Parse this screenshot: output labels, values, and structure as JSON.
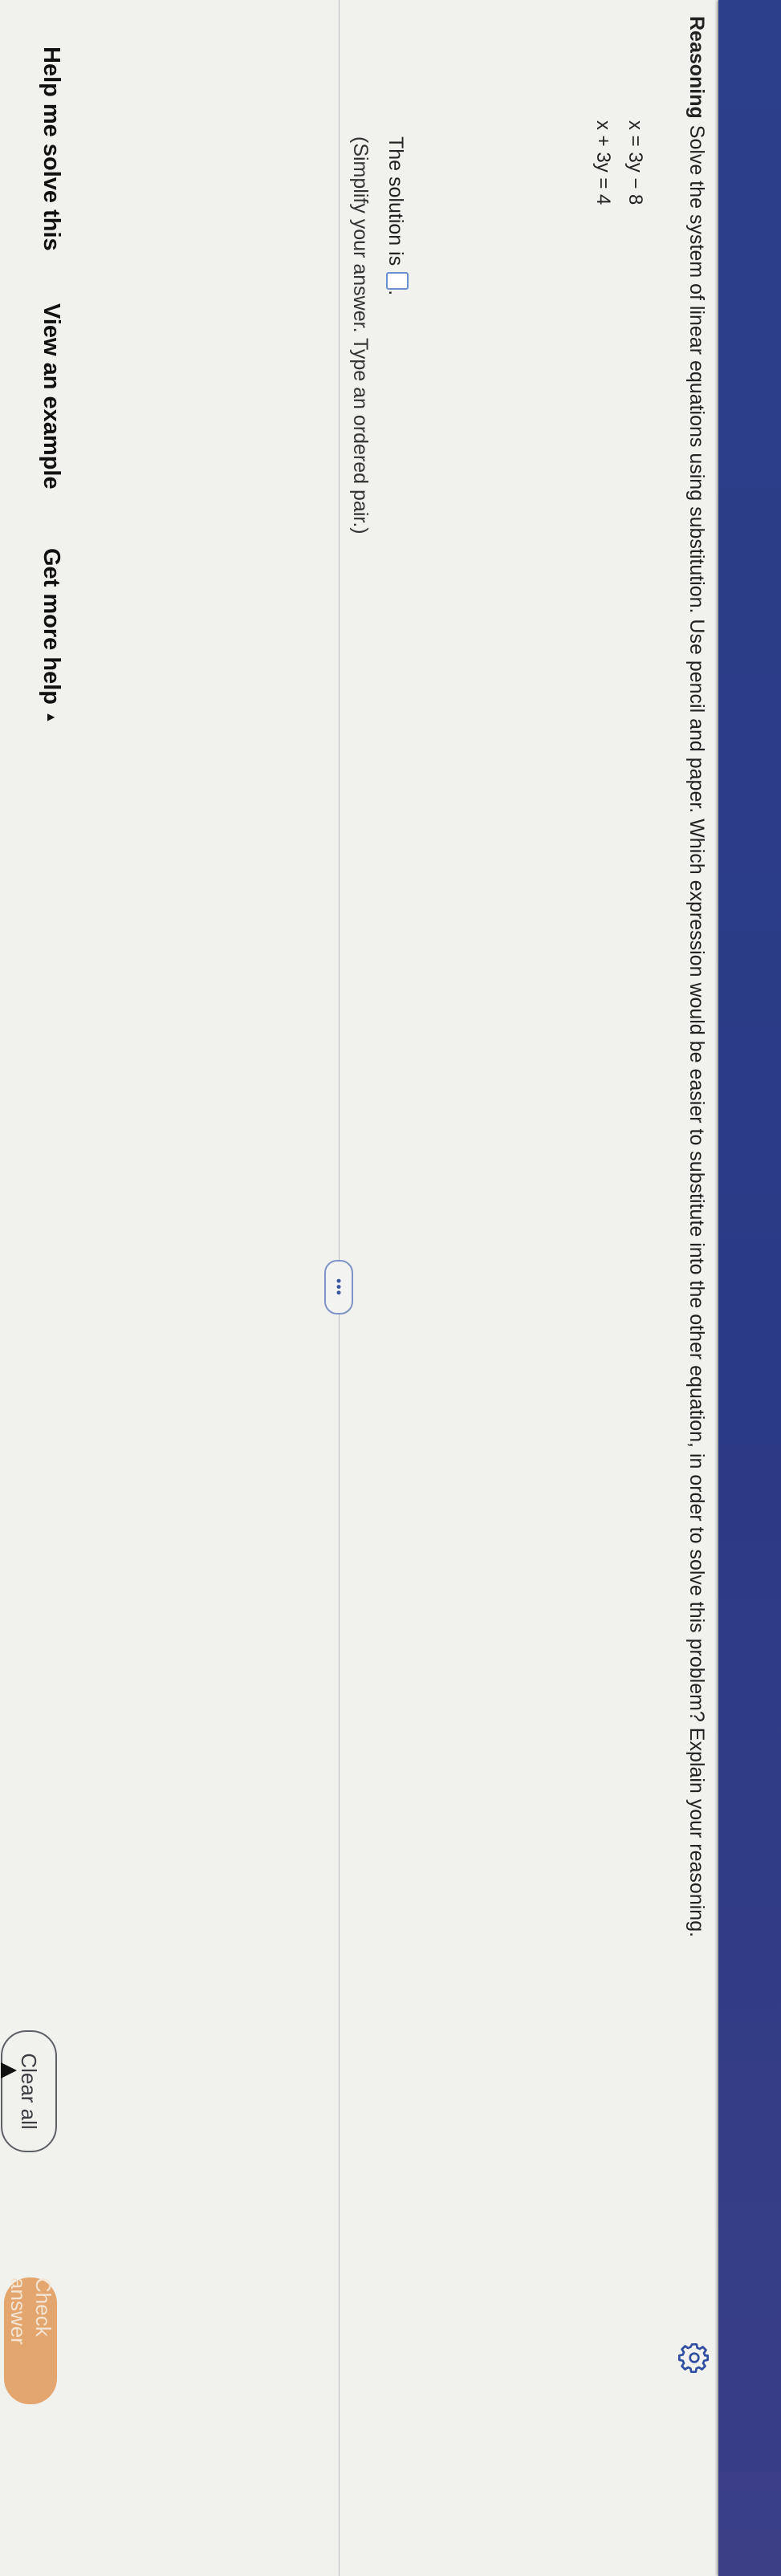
{
  "question": {
    "heading": "Reasoning",
    "text": "Solve the system of linear equations using substitution. Use pencil and paper. Which expression would be easier to substitute into the other equation, in order to solve this problem? Explain your reasoning.",
    "equations": [
      "x = 3y − 8",
      "x + 3y = 4"
    ]
  },
  "answer": {
    "prompt": "The solution is",
    "instruction": "(Simplify your answer. Type an ordered pair.)"
  },
  "help_links": {
    "solve": "Help me solve this",
    "example": "View an example",
    "more": "Get more help"
  },
  "buttons": {
    "clear": "Clear all",
    "check": "Check answer"
  },
  "more_indicator": "•••",
  "icons": [
    "gear-icon",
    "chevron-up-icon"
  ],
  "colors": {
    "header": "#2c3f8a",
    "check_button": "#e2a66e",
    "answer_box_border": "#6c8fd1"
  }
}
